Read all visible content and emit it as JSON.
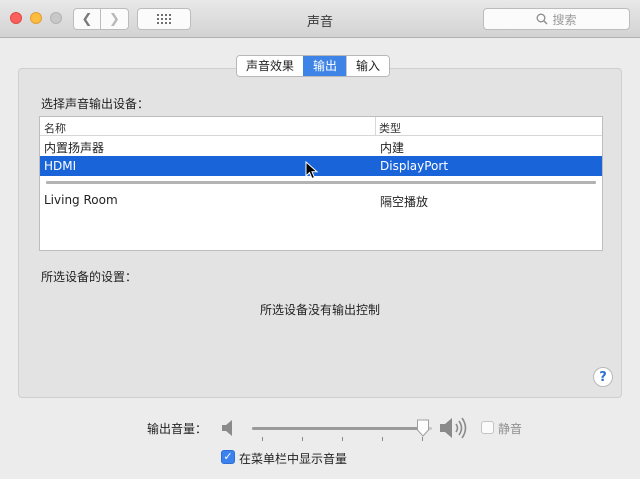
{
  "window": {
    "title": "声音",
    "search_placeholder": "搜索"
  },
  "tabs": [
    {
      "label": "声音效果",
      "active": false
    },
    {
      "label": "输出",
      "active": true
    },
    {
      "label": "输入",
      "active": false
    }
  ],
  "output": {
    "select_label": "选择声音输出设备：",
    "columns": {
      "name": "名称",
      "type": "类型"
    },
    "devices_top": [
      {
        "name": "内置扬声器",
        "type": "内建",
        "selected": false
      },
      {
        "name": "HDMI",
        "type": "DisplayPort",
        "selected": true
      }
    ],
    "devices_bottom": [
      {
        "name": "Living Room",
        "type": "隔空播放",
        "selected": false
      }
    ],
    "settings_label": "所选设备的设置：",
    "no_control_text": "所选设备没有输出控制"
  },
  "volume": {
    "label": "输出音量：",
    "level": 0.95,
    "mute_label": "静音",
    "mute_checked": false,
    "show_in_menubar_label": "在菜单栏中显示音量",
    "show_in_menubar_checked": true
  },
  "colors": {
    "accent": "#1a64d9",
    "tab_active": "#3e84e7"
  },
  "icons": {
    "back": "chevron-left-icon",
    "forward": "chevron-right-icon",
    "grid": "grid-icon",
    "search": "search-icon",
    "help": "help-icon",
    "speaker_low": "speaker-low-icon",
    "speaker_high": "speaker-high-icon"
  }
}
